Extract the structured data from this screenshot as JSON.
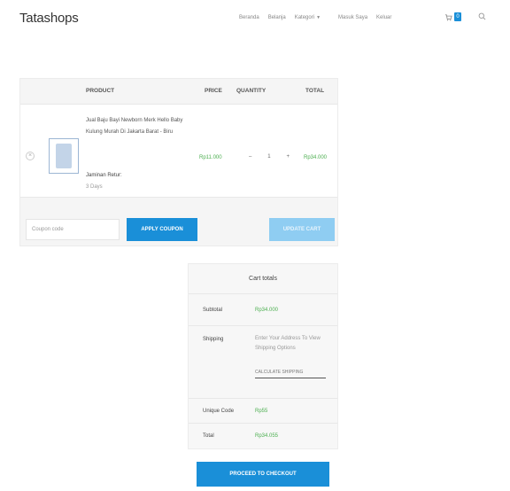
{
  "header": {
    "logo": "Tatashops",
    "nav": [
      "Beranda",
      "Belanja",
      "Kategori",
      "Masuk Saya",
      "Keluar"
    ],
    "cart_count": "0",
    "icons": {
      "cart": "cart-icon",
      "search": "search-icon",
      "dropdown": "chevron-down-icon"
    }
  },
  "cart": {
    "headers": {
      "product": "PRODUCT",
      "price": "PRICE",
      "quantity": "QUANTITY",
      "total": "TOTAL"
    },
    "item": {
      "remove": "×",
      "name": "Jual Baju Bayi Newborn Merk Hello Baby Kulung Murah Di Jakarta Barat - Biru",
      "extra_label": "Jaminan Retur:",
      "extra_value": "3 Days",
      "price": "Rp11.000",
      "qty": "1",
      "minus": "–",
      "plus": "+",
      "total": "Rp34.000"
    },
    "coupon_placeholder": "Coupon code",
    "apply_label": "APPLY COUPON",
    "update_label": "UPDATE CART"
  },
  "totals": {
    "title": "Cart totals",
    "subtotal_label": "Subtotal",
    "subtotal_value": "Rp34.000",
    "shipping_label": "Shipping",
    "shipping_note": "Enter Your Address To View Shipping Options",
    "calc_label": "CALCULATE SHIPPING",
    "unique_label": "Unique Code",
    "unique_value": "Rp55",
    "total_label": "Total",
    "total_value": "Rp34.055",
    "checkout_label": "PROCEED TO CHECKOUT"
  },
  "colors": {
    "accent": "#1a8fd8",
    "accent_light": "#8fcdf2",
    "price_green": "#4caf50"
  }
}
